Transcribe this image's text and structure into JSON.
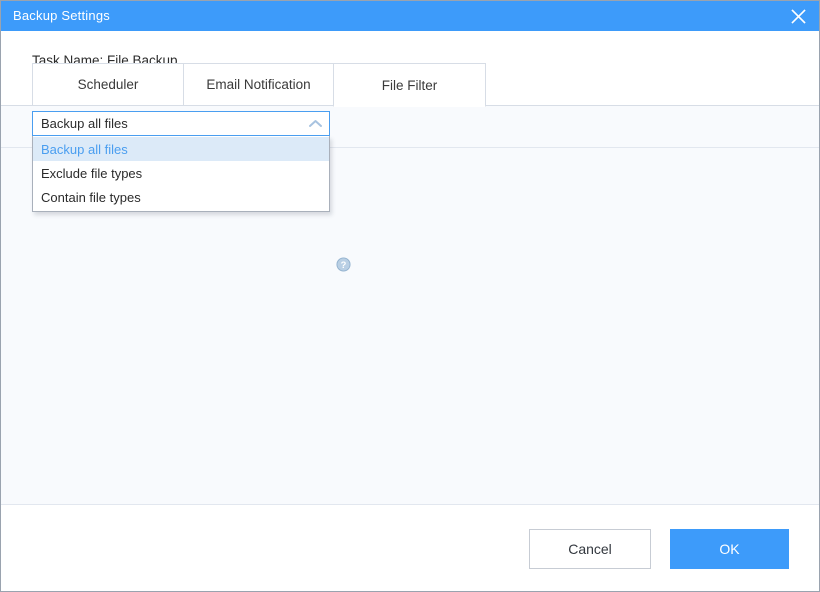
{
  "window": {
    "title": "Backup Settings",
    "close_icon": "close-icon",
    "accent_color": "#3d9bfa",
    "titlebar_text_color": "#ffffff"
  },
  "task": {
    "label": "Task Name: File Backup"
  },
  "tabs": [
    {
      "label": "Scheduler",
      "active": false
    },
    {
      "label": "Email Notification",
      "active": false
    },
    {
      "label": "File Filter",
      "active": true
    }
  ],
  "filter": {
    "combo": {
      "value": "Backup all files",
      "expanded": true,
      "arrow_icon": "chevron-up-icon",
      "border_color": "#4a9ef0",
      "options": [
        {
          "label": "Backup all files",
          "selected": true
        },
        {
          "label": "Exclude file types",
          "selected": false
        },
        {
          "label": "Contain file types",
          "selected": false
        }
      ],
      "highlight_bg": "#dceaf8",
      "highlight_text": "#4a9ef0"
    },
    "help_icon": "help-circle-icon"
  },
  "footer": {
    "cancel_label": "Cancel",
    "ok_label": "OK",
    "ok_color": "#3d9bfa"
  }
}
